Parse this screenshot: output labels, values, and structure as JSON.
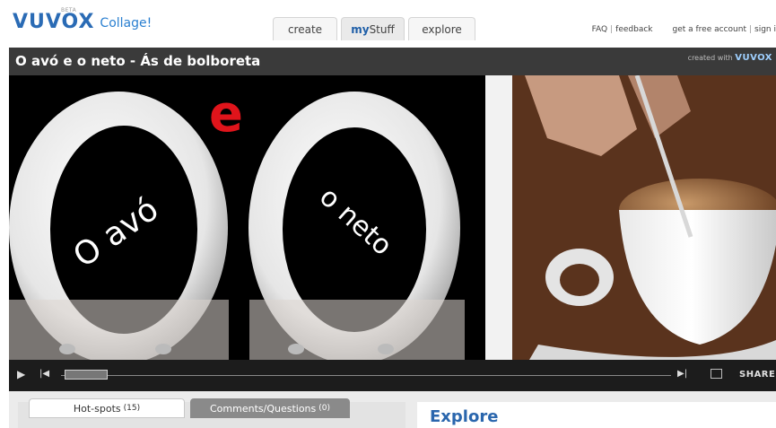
{
  "header": {
    "logo_text": "VUVOX",
    "logo_beta": "BETA",
    "app_name": "Collage!",
    "tabs": [
      {
        "label": "create"
      },
      {
        "label_bold": "my",
        "label_rest": "Stuff"
      },
      {
        "label": "explore"
      }
    ],
    "links": {
      "faq": "FAQ",
      "feedback": "feedback",
      "free_account": "get a free account",
      "sign_in": "sign i"
    }
  },
  "player": {
    "title": "O avó e o neto - Ás de bolboreta",
    "credit_prefix": "created with",
    "credit_brand": "VUVOX",
    "share_label": "SHARE",
    "scrub_position": 0.07,
    "artwork": {
      "left_text": "O avó",
      "middle_letter": "e",
      "right_text": "o neto"
    }
  },
  "bottom": {
    "tab_hotspots": "Hot-spots",
    "tab_hotspots_count": "(15)",
    "tab_comments": "Comments/Questions",
    "tab_comments_count": "(0)",
    "explore_heading": "Explore"
  },
  "colors": {
    "brand_blue": "#2a6bb5",
    "accent_red": "#e0141b",
    "player_bg": "#2b2b2b"
  }
}
